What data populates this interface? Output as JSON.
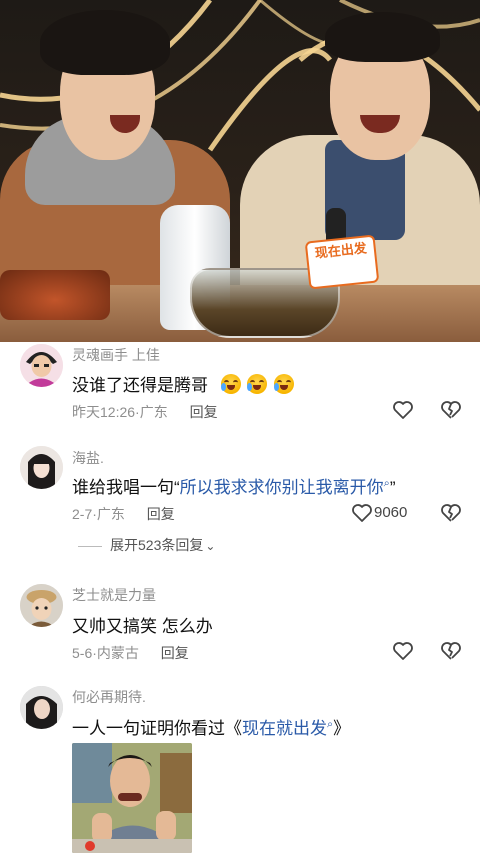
{
  "video": {
    "mic_flag_text": "现在出发"
  },
  "comments": [
    {
      "username": "灵魂画手 上佳",
      "text": "没谁了还得是腾哥",
      "emoji_count": 3,
      "emoji_name": "laugh-cry-emoji",
      "date": "昨天12:26",
      "location": "广东",
      "reply": "回复",
      "like_count": ""
    },
    {
      "username": "海盐.",
      "text_prefix": "谁给我唱一句“",
      "link_text": "所以我求求你别让我离开你",
      "text_suffix": "”",
      "date": "2-7",
      "location": "广东",
      "reply": "回复",
      "like_count": "9060"
    },
    {
      "username": "芝士就是力量",
      "text": "又帅又搞笑 怎么办",
      "date": "5-6",
      "location": "内蒙古",
      "reply": "回复",
      "like_count": ""
    },
    {
      "username": "何必再期待.",
      "text_prefix": "一人一句证明你看过《",
      "link_text": "现在就出发",
      "text_suffix": "》",
      "date": "",
      "location": "",
      "reply": "",
      "like_count": ""
    }
  ],
  "expand_replies": "展开523条回复",
  "icons": {
    "like": "heart-outline-icon",
    "dislike": "broken-heart-icon",
    "search_mark": "search-icon",
    "expand": "chevron-down-icon"
  },
  "colors": {
    "link": "#2a5aa8",
    "meta": "#8e8e8e"
  }
}
